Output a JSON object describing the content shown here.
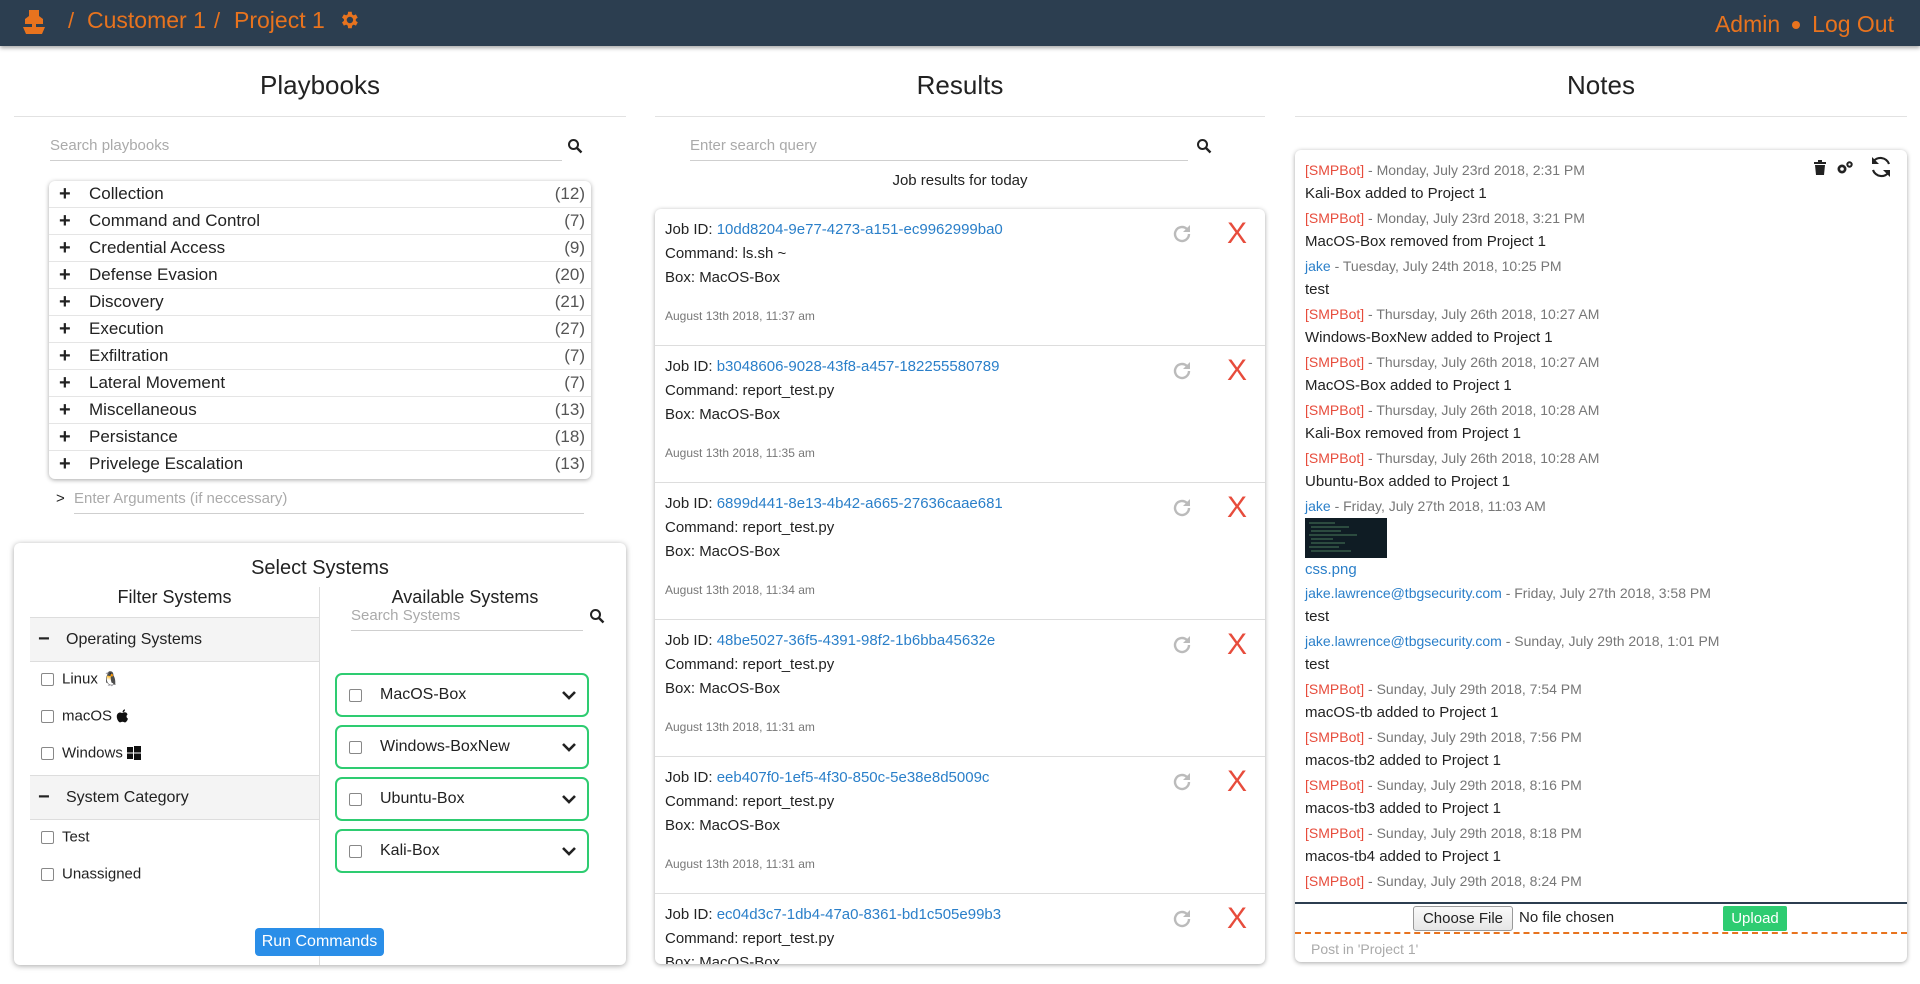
{
  "nav": {
    "customer": "Customer 1",
    "project": "Project 1",
    "sep": "/",
    "admin": "Admin",
    "logout": "Log Out"
  },
  "columns": {
    "playbooks": "Playbooks",
    "results": "Results",
    "notes": "Notes"
  },
  "playbooks": {
    "search_placeholder": "Search playbooks",
    "items": [
      {
        "name": "Collection",
        "count": "(12)"
      },
      {
        "name": "Command and Control",
        "count": "(7)"
      },
      {
        "name": "Credential Access",
        "count": "(9)"
      },
      {
        "name": "Defense Evasion",
        "count": "(20)"
      },
      {
        "name": "Discovery",
        "count": "(21)"
      },
      {
        "name": "Execution",
        "count": "(27)"
      },
      {
        "name": "Exfiltration",
        "count": "(7)"
      },
      {
        "name": "Lateral Movement",
        "count": "(7)"
      },
      {
        "name": "Miscellaneous",
        "count": "(13)"
      },
      {
        "name": "Persistance",
        "count": "(18)"
      },
      {
        "name": "Privelege Escalation",
        "count": "(13)"
      }
    ],
    "args_prompt": ">",
    "args_placeholder": "Enter Arguments (if neccessary)"
  },
  "systems": {
    "title": "Select Systems",
    "filter_title": "Filter Systems",
    "available_title": "Available Systems",
    "search_placeholder": "Search Systems",
    "os_group": "Operating Systems",
    "os_items": [
      "Linux",
      "macOS",
      "Windows"
    ],
    "cat_group": "System Category",
    "cat_items": [
      "Test",
      "Unassigned"
    ],
    "available": [
      "MacOS-Box",
      "Windows-BoxNew",
      "Ubuntu-Box",
      "Kali-Box"
    ],
    "run_label": "Run Commands"
  },
  "results": {
    "search_placeholder": "Enter search query",
    "subtitle": "Job results for today",
    "job_id_label": "Job ID: ",
    "command_label": "Command: ",
    "box_label": "Box: ",
    "delete_label": "X",
    "jobs": [
      {
        "id": "10dd8204-9e77-4273-a151-ec9962999ba0",
        "command": "ls.sh ~",
        "box": "MacOS-Box",
        "time": "August 13th 2018, 11:37 am"
      },
      {
        "id": "b3048606-9028-43f8-a457-182255580789",
        "command": "report_test.py",
        "box": "MacOS-Box",
        "time": "August 13th 2018, 11:35 am"
      },
      {
        "id": "6899d441-8e13-4b42-a665-27636caae681",
        "command": "report_test.py",
        "box": "MacOS-Box",
        "time": "August 13th 2018, 11:34 am"
      },
      {
        "id": "48be5027-36f5-4391-98f2-1b6bba45632e",
        "command": "report_test.py",
        "box": "MacOS-Box",
        "time": "August 13th 2018, 11:31 am"
      },
      {
        "id": "eeb407f0-1ef5-4f30-850c-5e38e8d5009c",
        "command": "report_test.py",
        "box": "MacOS-Box",
        "time": "August 13th 2018, 11:31 am"
      },
      {
        "id": "ec04d3c7-1db4-47a0-8361-bd1c505e99b3",
        "command": "report_test.py",
        "box": "MacOS-Box",
        "time": ""
      }
    ]
  },
  "notes": {
    "entries": [
      {
        "author": "[SMPBot]",
        "bot": true,
        "when": " - Monday, July 23rd 2018, 2:31 PM",
        "msg": "Kali-Box added to Project 1"
      },
      {
        "author": "[SMPBot]",
        "bot": true,
        "when": " - Monday, July 23rd 2018, 3:21 PM",
        "msg": "MacOS-Box removed from Project 1"
      },
      {
        "author": "jake",
        "bot": false,
        "when": " - Tuesday, July 24th 2018, 10:25 PM",
        "msg": "test"
      },
      {
        "author": "[SMPBot]",
        "bot": true,
        "when": " - Thursday, July 26th 2018, 10:27 AM",
        "msg": "Windows-BoxNew added to Project 1"
      },
      {
        "author": "[SMPBot]",
        "bot": true,
        "when": " - Thursday, July 26th 2018, 10:27 AM",
        "msg": "MacOS-Box added to Project 1"
      },
      {
        "author": "[SMPBot]",
        "bot": true,
        "when": " - Thursday, July 26th 2018, 10:28 AM",
        "msg": "Kali-Box removed from Project 1"
      },
      {
        "author": "[SMPBot]",
        "bot": true,
        "when": " - Thursday, July 26th 2018, 10:28 AM",
        "msg": "Ubuntu-Box added to Project 1"
      },
      {
        "author": "jake",
        "bot": false,
        "when": " - Friday, July 27th 2018, 11:03 AM",
        "msg": ""
      }
    ],
    "attachment": "css.png",
    "entries2": [
      {
        "author": "jake.lawrence@tbgsecurity.com",
        "bot": false,
        "when": " - Friday, July 27th 2018, 3:58 PM",
        "msg": "test"
      },
      {
        "author": "jake.lawrence@tbgsecurity.com",
        "bot": false,
        "when": " - Sunday, July 29th 2018, 1:01 PM",
        "msg": "test"
      },
      {
        "author": "[SMPBot]",
        "bot": true,
        "when": " - Sunday, July 29th 2018, 7:54 PM",
        "msg": "macOS-tb added to Project 1"
      },
      {
        "author": "[SMPBot]",
        "bot": true,
        "when": " - Sunday, July 29th 2018, 7:56 PM",
        "msg": "macos-tb2 added to Project 1"
      },
      {
        "author": "[SMPBot]",
        "bot": true,
        "when": " - Sunday, July 29th 2018, 8:16 PM",
        "msg": "macos-tb3 added to Project 1"
      },
      {
        "author": "[SMPBot]",
        "bot": true,
        "when": " - Sunday, July 29th 2018, 8:18 PM",
        "msg": "macos-tb4 added to Project 1"
      },
      {
        "author": "[SMPBot]",
        "bot": true,
        "when": " - Sunday, July 29th 2018, 8:24 PM",
        "msg": ""
      }
    ],
    "choose_file": "Choose File",
    "no_file": "No file chosen",
    "upload": "Upload",
    "post_placeholder": "Post in 'Project 1'"
  }
}
